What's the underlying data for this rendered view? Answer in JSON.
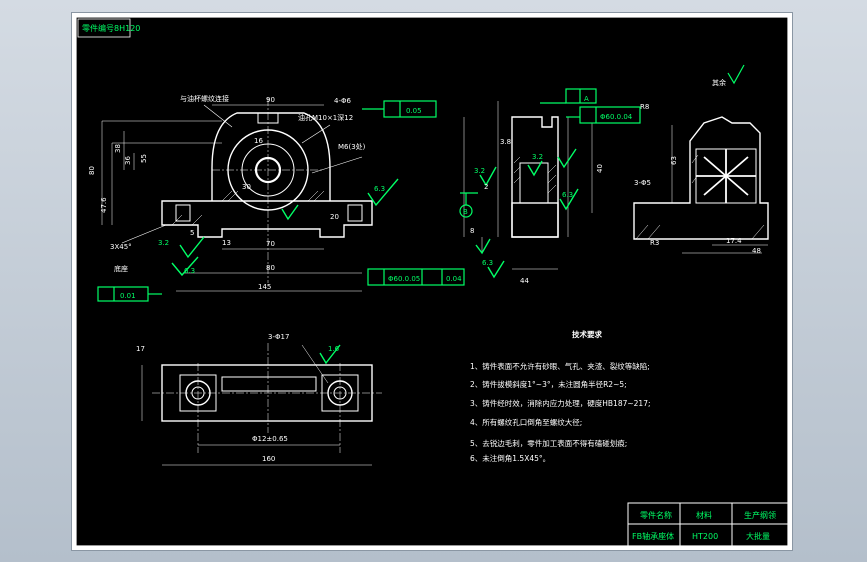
{
  "sheet": {
    "stamp": "零件编号8H120",
    "dimensions": {
      "d90": "90",
      "d16": "16",
      "d4_6": "4-Φ6",
      "d30": "30",
      "d70": "70",
      "d80": "80",
      "d145": "145",
      "d20": "20",
      "d5": "5",
      "d38": "38",
      "d55": "55",
      "d476": "47.6",
      "d36": "36",
      "d13": "13",
      "d07": "0.7",
      "d150": "150",
      "d160": "160",
      "d3_17": "3-Φ17",
      "d12_65": "Φ12±0.65",
      "d38b": "3.8",
      "d44": "44",
      "d2": "2",
      "d8": "8",
      "d39": "39",
      "d40": "40",
      "d17": "17",
      "d174": "17.4",
      "d48": "48",
      "d3_0": "3-Φ5",
      "dR8": "R8",
      "dR3": "R3",
      "d63": "63",
      "dR5": "R5"
    },
    "callouts": {
      "oil_cup": "与油杯螺纹连接",
      "oil_hole": "油孔M10×1深12",
      "m6": "M6(3处)",
      "chamfer": "3X45°",
      "base_note": "底座"
    },
    "gdt": {
      "perp": "0.05",
      "parallel_top": "Φ60.0.04",
      "flat": "0.01",
      "parallel_b": "Φ60.0.05",
      "flat_b": "0.04",
      "s_ref": "A",
      "b_ref": "B"
    },
    "roughness": {
      "r1": "6.3",
      "r2": "6.3",
      "r3": "3.2",
      "r4": "3.2",
      "r5": "6.3",
      "r6": "6.3",
      "r7": "6.3",
      "r8": "6.3",
      "r9": "3.2",
      "r10": "1.6",
      "rest": "其余"
    },
    "notes": {
      "title": "技术要求",
      "l1": "1、铸件表面不允许有砂眼、气孔、夹渣、裂纹等缺陷;",
      "l2": "2、铸件拔模斜度1°~3°，未注圆角半径R2~5;",
      "l3": "3、铸件经时效，消除内应力处理，硬度HB187~217;",
      "l4": "4、所有螺纹孔口倒角至螺纹大径;",
      "l5": "5、去锐边毛刺，零件加工表面不得有磕碰划痕;",
      "l6": "6、未注倒角1.5X45°。"
    },
    "titleblock": {
      "h1": "零件名称",
      "h2": "材料",
      "h3": "生产纲领",
      "v1": "FB轴承座体",
      "v2": "HT200",
      "v3": "大批量"
    }
  }
}
